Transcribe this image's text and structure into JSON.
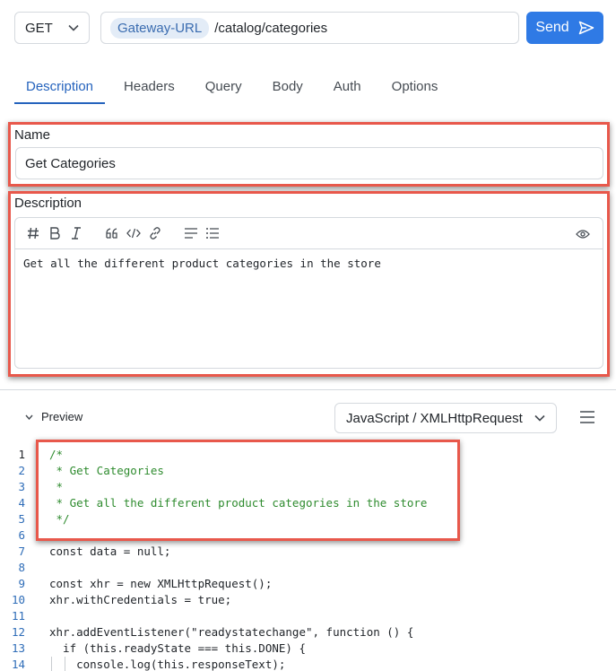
{
  "request": {
    "method": "GET",
    "env_chip": "Gateway-URL",
    "path": "/catalog/categories",
    "send_label": "Send"
  },
  "tabs": [
    {
      "label": "Description",
      "active": true
    },
    {
      "label": "Headers"
    },
    {
      "label": "Query"
    },
    {
      "label": "Body"
    },
    {
      "label": "Auth"
    },
    {
      "label": "Options"
    }
  ],
  "name_section": {
    "label": "Name",
    "value": "Get Categories"
  },
  "description_section": {
    "label": "Description",
    "body": "Get all the different product categories in the store",
    "toolbar_icons": [
      "heading-icon",
      "bold-icon",
      "italic-icon",
      "quote-icon",
      "code-icon",
      "link-icon",
      "bullet-list-icon",
      "numbered-list-icon",
      "preview-eye-icon"
    ]
  },
  "preview": {
    "toggle_label": "Preview",
    "language": "JavaScript / XMLHttpRequest"
  },
  "code": {
    "lines": [
      {
        "n": "1",
        "text": "/*"
      },
      {
        "n": "2",
        "text": " * Get Categories"
      },
      {
        "n": "3",
        "text": " *"
      },
      {
        "n": "4",
        "text": " * Get all the different product categories in the store"
      },
      {
        "n": "5",
        "text": " */"
      },
      {
        "n": "6",
        "text": ""
      },
      {
        "n": "7",
        "text": "const data = null;"
      },
      {
        "n": "8",
        "text": ""
      },
      {
        "n": "9",
        "text": "const xhr = new XMLHttpRequest();"
      },
      {
        "n": "10",
        "text": "xhr.withCredentials = true;"
      },
      {
        "n": "11",
        "text": ""
      },
      {
        "n": "12",
        "text": "xhr.addEventListener(\"readystatechange\", function () {"
      },
      {
        "n": "13",
        "text": "  if (this.readyState === this.DONE) {"
      },
      {
        "n": "14",
        "text": "    console.log(this.responseText);"
      }
    ]
  },
  "colors": {
    "accent": "#2f7ae5",
    "highlight": "#e8584b",
    "comment": "#2e8b2e",
    "string": "#6e7781"
  }
}
